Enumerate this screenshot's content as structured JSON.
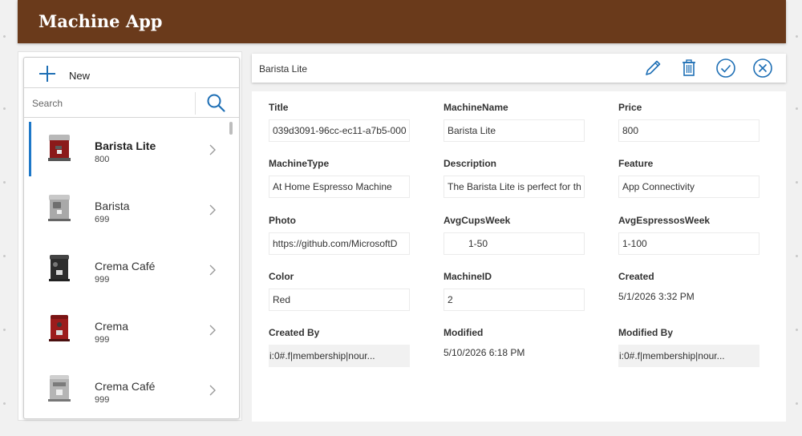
{
  "app": {
    "title": "Machine App"
  },
  "gallery": {
    "new_label": "New",
    "search_placeholder": "Search",
    "items": [
      {
        "name": "Barista Lite",
        "price": "800",
        "selected": true,
        "color": "#8b1a1a"
      },
      {
        "name": "Barista",
        "price": "699",
        "selected": false,
        "color": "#9a9a9a"
      },
      {
        "name": "Crema Café",
        "price": "999",
        "selected": false,
        "color": "#2d2d2d"
      },
      {
        "name": "Crema",
        "price": "999",
        "selected": false,
        "color": "#9c1c1c"
      },
      {
        "name": "Crema Café",
        "price": "999",
        "selected": false,
        "color": "#a8a8a8"
      }
    ]
  },
  "detail": {
    "title": "Barista Lite",
    "icons": [
      "edit-icon",
      "delete-icon",
      "submit-icon",
      "cancel-icon"
    ],
    "fields": {
      "title": {
        "label": "Title",
        "value": "039d3091-96cc-ec11-a7b5-000"
      },
      "machine_name": {
        "label": "MachineName",
        "value": "Barista Lite"
      },
      "price": {
        "label": "Price",
        "value": "800"
      },
      "machine_type": {
        "label": "MachineType",
        "value": "At Home Espresso Machine"
      },
      "description": {
        "label": "Description",
        "value": "The Barista Lite is perfect for th"
      },
      "feature": {
        "label": "Feature",
        "value": "App Connectivity"
      },
      "photo": {
        "label": "Photo",
        "value": "https://github.com/MicrosoftD"
      },
      "avg_cups_week": {
        "label": "AvgCupsWeek",
        "value": "1-50"
      },
      "avg_espressos_week": {
        "label": "AvgEspressosWeek",
        "value": "1-100"
      },
      "color": {
        "label": "Color",
        "value": "Red"
      },
      "machine_id": {
        "label": "MachineID",
        "value": "2"
      },
      "created": {
        "label": "Created",
        "value": "5/1/2026 3:32 PM"
      },
      "created_by": {
        "label": "Created By",
        "value": "i:0#.f|membership|nour..."
      },
      "modified": {
        "label": "Modified",
        "value": "5/10/2026 6:18 PM"
      },
      "modified_by": {
        "label": "Modified By",
        "value": "i:0#.f|membership|nour..."
      }
    }
  },
  "colors": {
    "header": "#6a3a1b",
    "accent": "#1e78c8",
    "icon": "#1e6fb5"
  }
}
